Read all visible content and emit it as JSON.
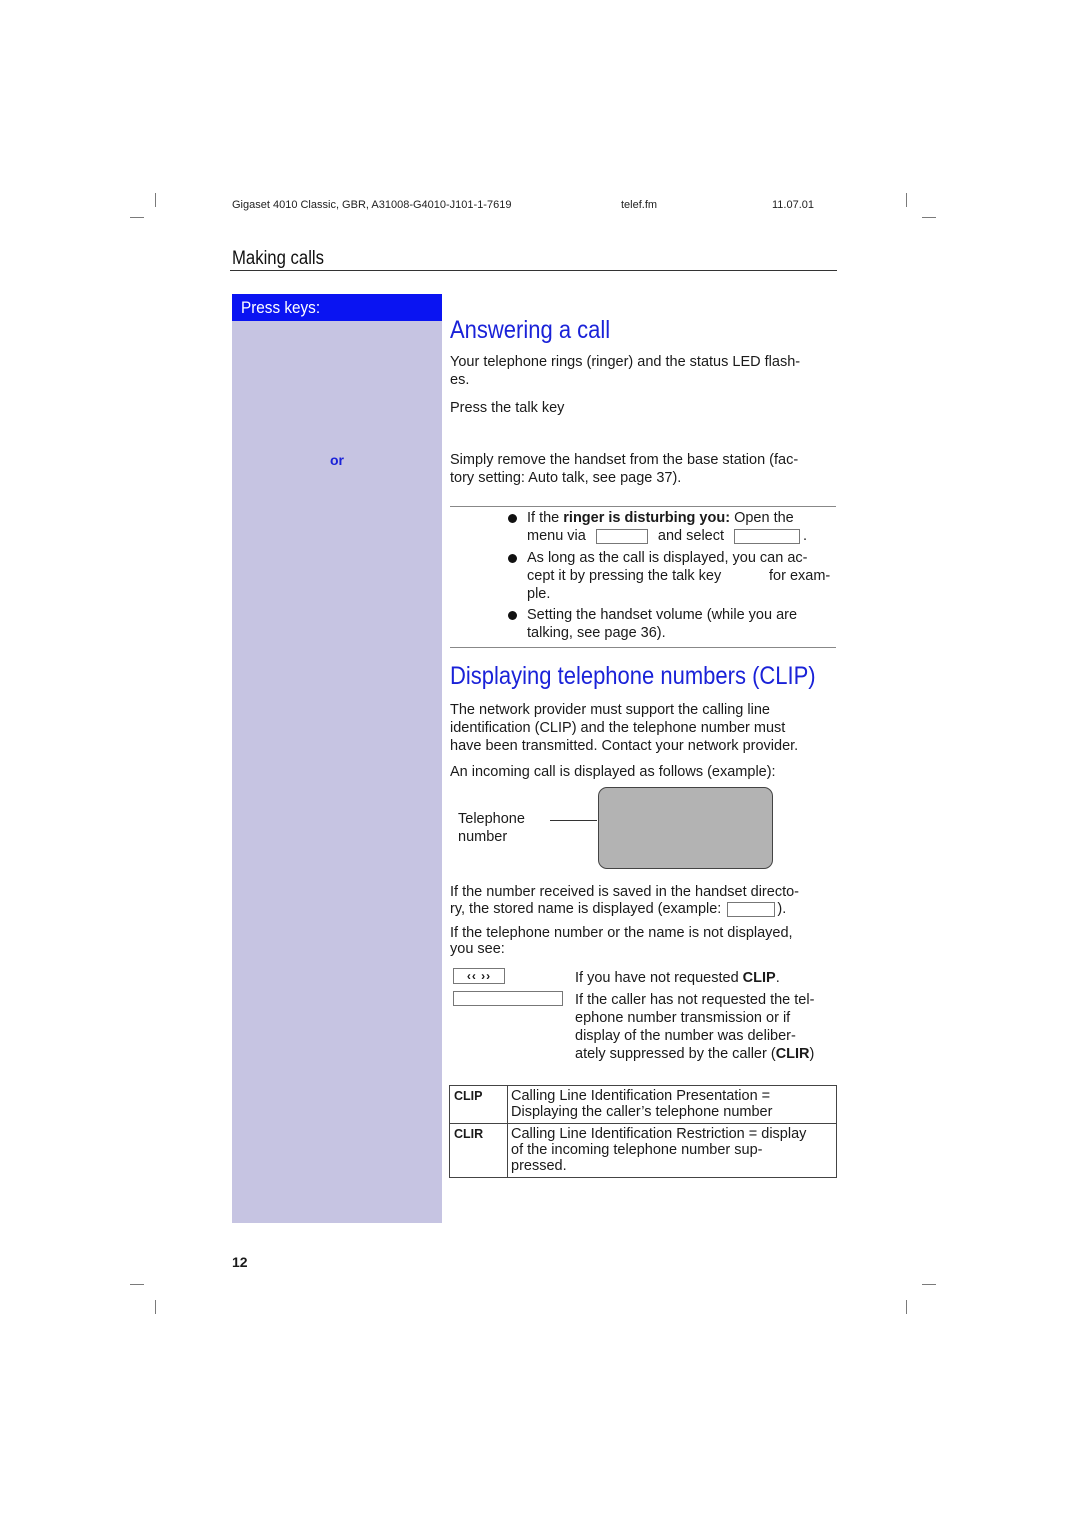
{
  "header": {
    "document": "Gigaset 4010 Classic, GBR, A31008-G4010-J101-1-7619",
    "file": "telef.fm",
    "date": "11.07.01"
  },
  "section": {
    "title": "Making calls"
  },
  "sidebar": {
    "label": "Press keys:",
    "or_label": "or",
    "background_color": "#c6c4e2",
    "label_background_color": "#0a14f2"
  },
  "answering": {
    "title": "Answering a call",
    "para1_line1": "Your telephone rings (ringer) and the status LED flash-",
    "para1_line2": "es.",
    "para2": "Press the talk key",
    "para3_line1": "Simply remove the handset from the base station (fac-",
    "para3_line2": "tory setting: Auto talk, see page 37).",
    "tips": [
      {
        "line1_prefix": "If the ",
        "line1_bold": "ringer is disturbing you:",
        "line1_suffix": " Open the",
        "line2_a": "menu via",
        "line2_b": "and select",
        "line2_c": "."
      },
      {
        "line1": "As long as the call is displayed, you can ac-",
        "line2_a": "cept it by pressing the talk key",
        "line2_b": "for exam-",
        "line3": "ple."
      },
      {
        "line1": "Setting the handset volume (while you are",
        "line2": "talking, see page 36)."
      }
    ]
  },
  "clip": {
    "title": "Displaying telephone numbers (CLIP)",
    "para1_line1": "The network provider must support the calling line",
    "para1_line2": "identification (CLIP) and the telephone number must",
    "para1_line3": "have been transmitted. Contact your network provider.",
    "para2": "An incoming call is displayed as follows (example):",
    "display_label_line1": "Telephone",
    "display_label_line2": "number",
    "para3_line1": "If the number received is saved in the handset directo-",
    "para3_line2_a": "ry, the stored name is displayed (example:",
    "para3_line2_b": ").",
    "para4_line1": "If the telephone number or the name is not displayed,",
    "para4_line2": "you see:",
    "cases": [
      {
        "display": "‹‹ ››",
        "text_prefix": "If you have not requested ",
        "text_bold": "CLIP",
        "text_suffix": "."
      },
      {
        "display": "",
        "line1": "If the caller has not requested the tel-",
        "line2": "ephone number transmission or if",
        "line3": "display of the number was deliber-",
        "line4_prefix": "ately suppressed by the caller (",
        "line4_bold": "CLIR",
        "line4_suffix": ")"
      }
    ],
    "glossary": [
      {
        "term": "CLIP",
        "definition_line1": "Calling Line Identification Presentation =",
        "definition_line2": "Displaying the caller’s telephone number"
      },
      {
        "term": "CLIR",
        "definition_line1": "Calling Line Identification Restriction = display",
        "definition_line2": "of the incoming telephone number sup-",
        "definition_line3": "pressed."
      }
    ]
  },
  "footer": {
    "page_number": "12"
  }
}
